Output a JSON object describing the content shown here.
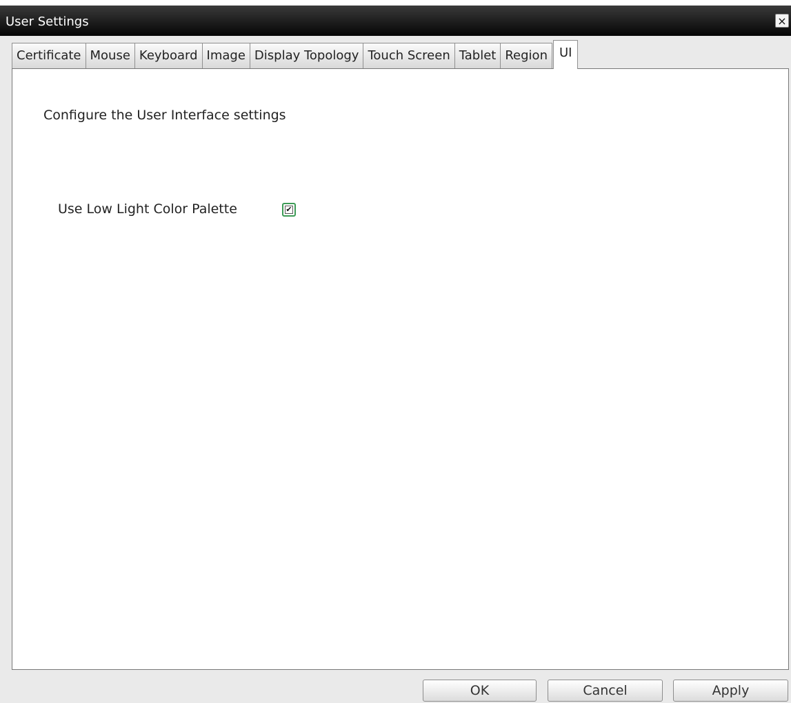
{
  "window": {
    "title": "User Settings",
    "close_glyph": "×"
  },
  "tabs": [
    {
      "label": "Certificate",
      "active": false
    },
    {
      "label": "Mouse",
      "active": false
    },
    {
      "label": "Keyboard",
      "active": false
    },
    {
      "label": "Image",
      "active": false
    },
    {
      "label": "Display Topology",
      "active": false
    },
    {
      "label": "Touch Screen",
      "active": false
    },
    {
      "label": "Tablet",
      "active": false
    },
    {
      "label": "Region",
      "active": false
    },
    {
      "label": "UI",
      "active": true
    }
  ],
  "panel": {
    "description": "Configure the User Interface settings",
    "low_light": {
      "label": "Use Low Light Color Palette",
      "checked": true,
      "check_glyph": "✔"
    }
  },
  "buttons": {
    "ok": "OK",
    "cancel": "Cancel",
    "apply": "Apply"
  },
  "colors": {
    "checkbox_focus": "#3c9a55",
    "titlebar": "#050505"
  }
}
